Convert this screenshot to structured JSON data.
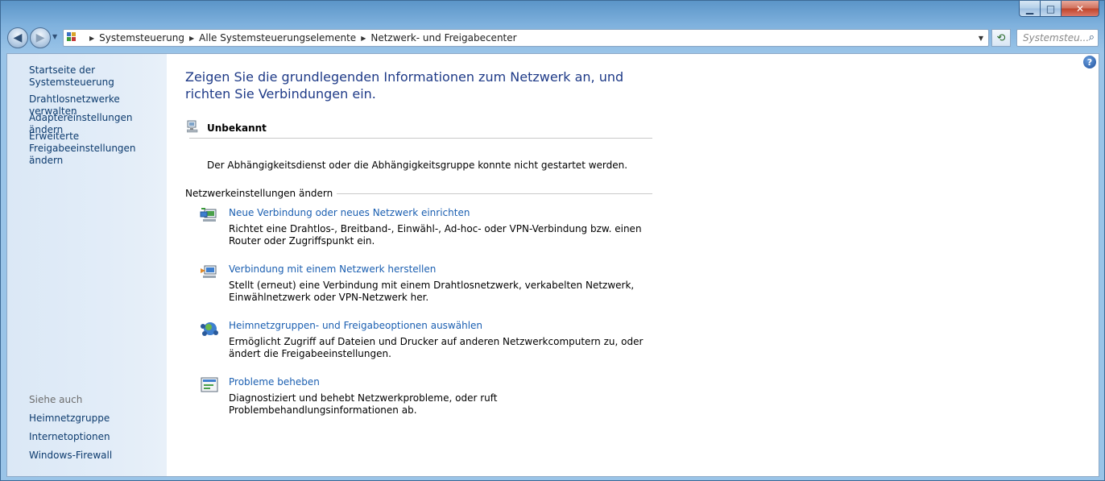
{
  "window": {
    "controls": {
      "minimize": "▁",
      "maximize": "□",
      "close": "✕"
    }
  },
  "address_bar": {
    "breadcrumbs": [
      "Systemsteuerung",
      "Alle Systemsteuerungselemente",
      "Netzwerk- und Freigabecenter"
    ],
    "search_placeholder": "Systemsteu..."
  },
  "sidebar": {
    "home_link": "Startseite der Systemsteuerung",
    "links": [
      "Drahtlosnetzwerke verwalten",
      "Adaptereinstellungen ändern",
      "Erweiterte Freigabeeinstellungen ändern"
    ],
    "see_also_title": "Siehe auch",
    "see_also": [
      "Heimnetzgruppe",
      "Internetoptionen",
      "Windows-Firewall"
    ]
  },
  "main": {
    "heading": "Zeigen Sie die grundlegenden Informationen zum Netzwerk an, und richten Sie Verbindungen ein.",
    "network_name": "Unbekannt",
    "network_status": "Der Abhängigkeitsdienst oder die Abhängigkeitsgruppe konnte nicht gestartet werden.",
    "section_title": "Netzwerkeinstellungen ändern",
    "tasks": [
      {
        "title": "Neue Verbindung oder neues Netzwerk einrichten",
        "description": "Richtet eine Drahtlos-, Breitband-, Einwähl-, Ad-hoc- oder VPN-Verbindung bzw. einen Router oder Zugriffspunkt ein."
      },
      {
        "title": "Verbindung mit einem Netzwerk herstellen",
        "description": "Stellt (erneut) eine Verbindung mit einem Drahtlosnetzwerk, verkabelten Netzwerk, Einwählnetzwerk oder VPN-Netzwerk her."
      },
      {
        "title": "Heimnetzgruppen- und Freigabeoptionen auswählen",
        "description": "Ermöglicht Zugriff auf Dateien und Drucker auf anderen Netzwerkcomputern zu, oder ändert die Freigabeeinstellungen."
      },
      {
        "title": "Probleme beheben",
        "description": "Diagnostiziert und behebt Netzwerkprobleme, oder ruft Problembehandlungsinformationen ab."
      }
    ]
  }
}
